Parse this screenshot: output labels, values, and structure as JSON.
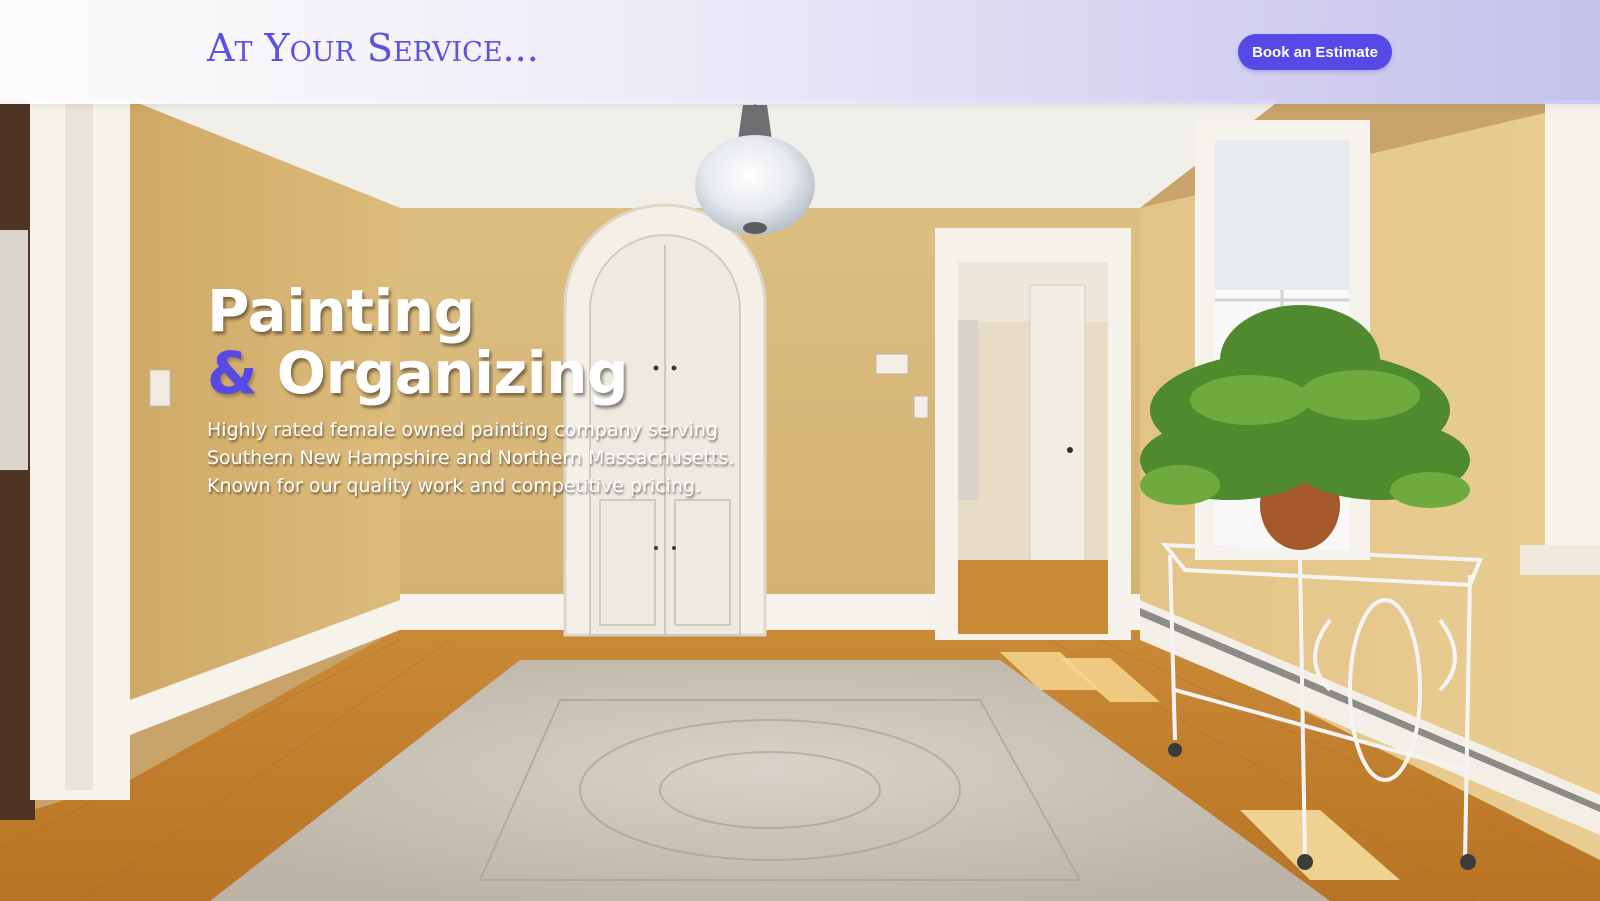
{
  "header": {
    "logo_text": "At Your Service...",
    "cta_label": "Book an Estimate"
  },
  "hero": {
    "title_line1": "Painting",
    "title_amp": "&",
    "title_line2": "Organizing",
    "subtitle_lines": [
      "Highly rated female owned painting company serving",
      "Southern New Hampshire and Northern Massachusetts.",
      "Known for our quality work and competitive pricing."
    ]
  },
  "colors": {
    "accent": "#5649e6",
    "wall": "#d9b978",
    "floor": "#c8842e",
    "trim": "#f4f1ea"
  }
}
